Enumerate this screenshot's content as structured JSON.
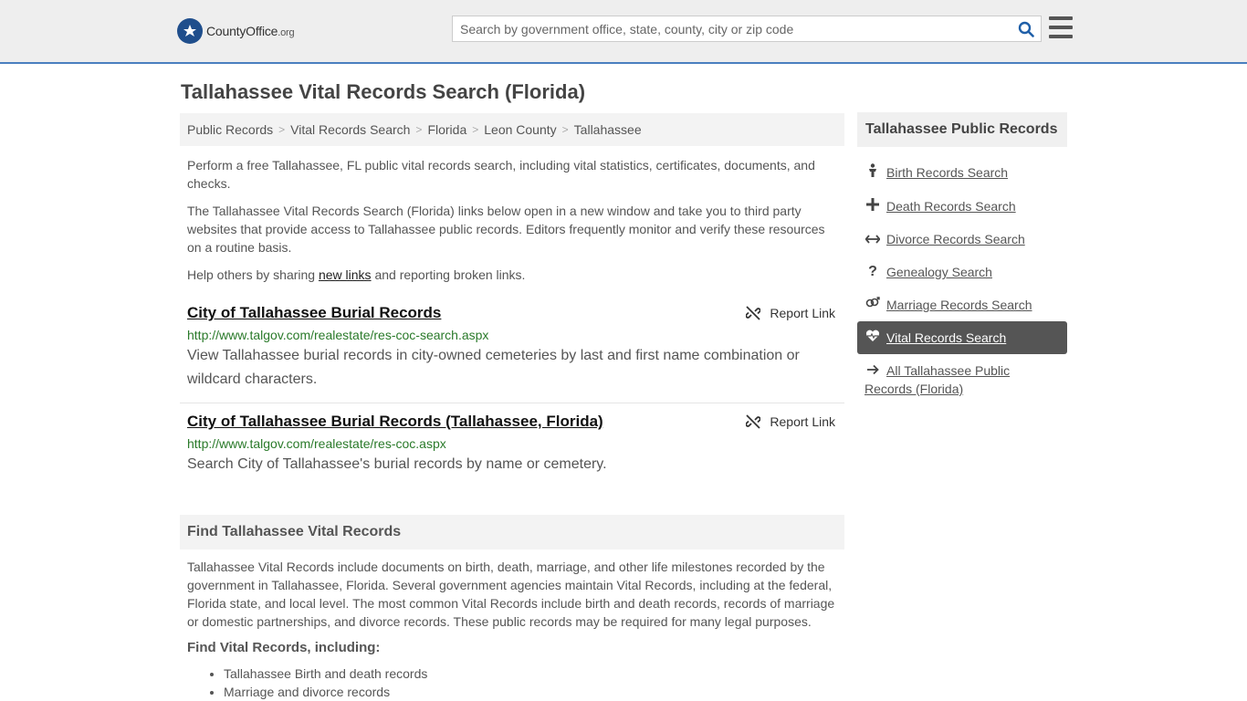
{
  "header": {
    "logo_name": "CountyOffice",
    "logo_suffix": ".org",
    "search_placeholder": "Search by government office, state, county, city or zip code"
  },
  "page": {
    "title": "Tallahassee Vital Records Search (Florida)"
  },
  "breadcrumb": [
    "Public Records",
    "Vital Records Search",
    "Florida",
    "Leon County",
    "Tallahassee"
  ],
  "intro": {
    "p1": "Perform a free Tallahassee, FL public vital records search, including vital statistics, certificates, documents, and checks.",
    "p2": "The Tallahassee Vital Records Search (Florida) links below open in a new window and take you to third party websites that provide access to Tallahassee public records. Editors frequently monitor and verify these resources on a routine basis.",
    "p3_before": "Help others by sharing ",
    "p3_link": "new links",
    "p3_after": " and reporting broken links."
  },
  "results": [
    {
      "title": "City of Tallahassee Burial Records",
      "url": "http://www.talgov.com/realestate/res-coc-search.aspx",
      "desc": "View Tallahassee burial records in city-owned cemeteries by last and first name combination or wildcard characters.",
      "report": "Report Link"
    },
    {
      "title": "City of Tallahassee Burial Records (Tallahassee, Florida)",
      "url": "http://www.talgov.com/realestate/res-coc.aspx",
      "desc": "Search City of Tallahassee's burial records by name or cemetery.",
      "report": "Report Link"
    }
  ],
  "find": {
    "heading": "Find Tallahassee Vital Records",
    "body": "Tallahassee Vital Records include documents on birth, death, marriage, and other life milestones recorded by the government in Tallahassee, Florida. Several government agencies maintain Vital Records, including at the federal, Florida state, and local level. The most common Vital Records include birth and death records, records of marriage or domestic partnerships, and divorce records. These public records may be required for many legal purposes.",
    "subheading": "Find Vital Records, including:",
    "bullets": [
      "Tallahassee Birth and death records",
      "Marriage and divorce records"
    ]
  },
  "sidebar": {
    "heading": "Tallahassee Public Records",
    "items": [
      {
        "label": "Birth Records Search",
        "icon": "person-icon"
      },
      {
        "label": "Death Records Search",
        "icon": "cross-icon"
      },
      {
        "label": "Divorce Records Search",
        "icon": "arrows-icon"
      },
      {
        "label": "Genealogy Search",
        "icon": "question-icon"
      },
      {
        "label": "Marriage Records Search",
        "icon": "gender-icon"
      },
      {
        "label": "Vital Records Search",
        "icon": "heart-icon",
        "active": true
      },
      {
        "label": "All Tallahassee Public Records (Florida)",
        "icon": "arrow-right-icon"
      }
    ]
  },
  "colors": {
    "header_bg": "#eeeeee",
    "header_border": "#4a7fbf",
    "url_green": "#2a7a2a",
    "active_bg": "#555555",
    "search_icon": "#1f5fa8"
  }
}
